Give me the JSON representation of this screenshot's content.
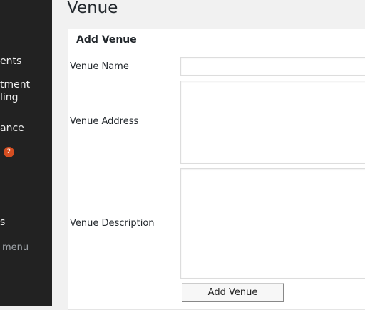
{
  "sidebar": {
    "items": [
      {
        "label": "ents"
      },
      {
        "label": "tment"
      },
      {
        "label": "ling"
      },
      {
        "label": "ance"
      },
      {
        "label": "s"
      },
      {
        "label": "menu"
      }
    ],
    "badge_count": "2"
  },
  "page": {
    "title": "Venue"
  },
  "form": {
    "heading": "Add Venue",
    "name_label": "Venue Name",
    "name_value": "",
    "address_label": "Venue Address",
    "address_value": "",
    "description_label": "Venue Description",
    "description_value": "",
    "submit_label": "Add Venue"
  },
  "colors": {
    "sidebar": "#222222",
    "badge": "#d54e21",
    "background": "#f1f1f1"
  }
}
